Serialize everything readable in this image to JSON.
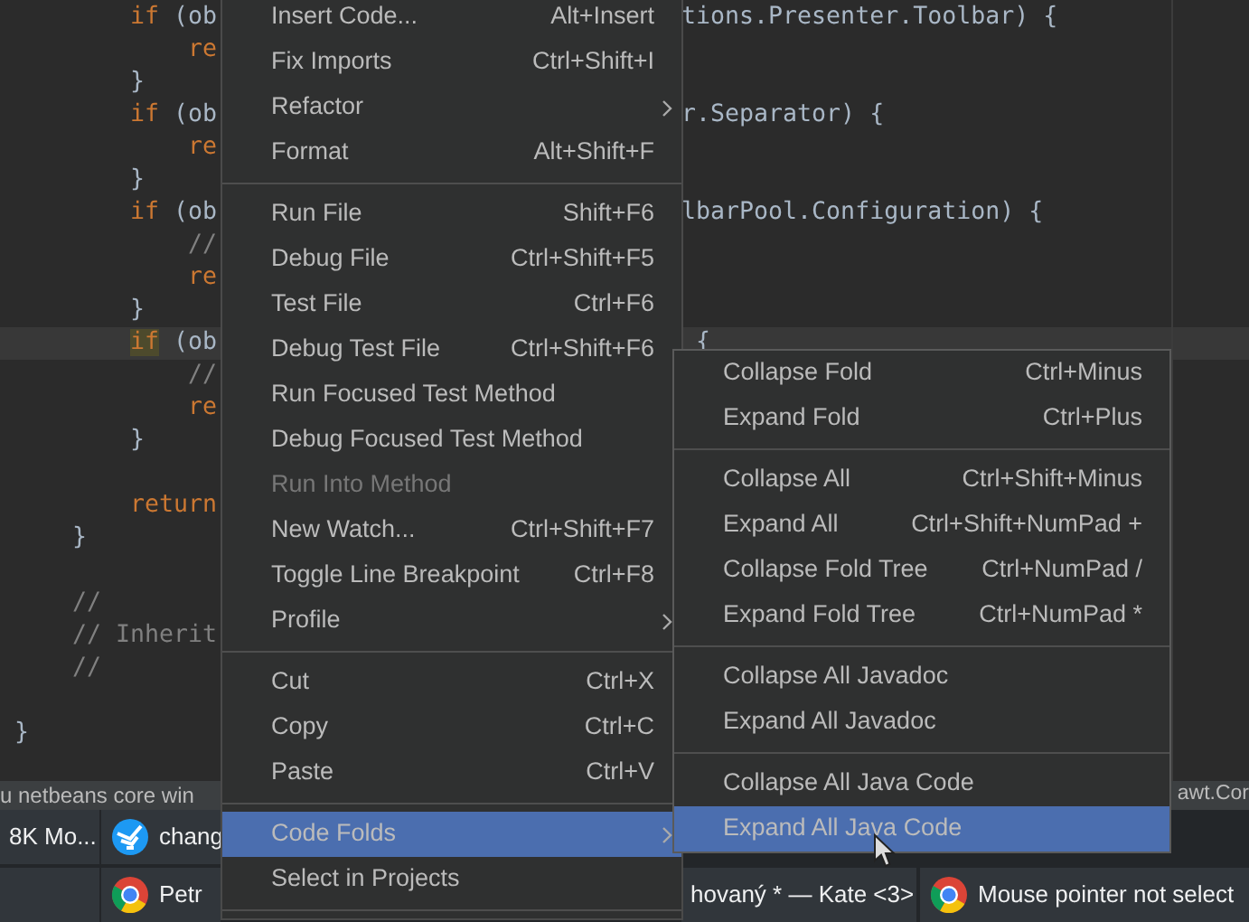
{
  "editor": {
    "lines": [
      {
        "segments": [
          {
            "text": "if",
            "kind": "keyword"
          },
          {
            "text": " (ob",
            "kind": "plain"
          }
        ],
        "right": "tions.Presenter.Toolbar) {",
        "current": false
      },
      {
        "segments": [
          {
            "text": "re",
            "kind": "keyword"
          }
        ],
        "current": false
      },
      {
        "segments": [
          {
            "text": "}",
            "kind": "plain"
          }
        ],
        "current": false
      },
      {
        "segments": [
          {
            "text": "if",
            "kind": "keyword"
          },
          {
            "text": " (ob",
            "kind": "plain"
          }
        ],
        "right": "r.Separator) {",
        "current": false
      },
      {
        "segments": [
          {
            "text": "re",
            "kind": "keyword"
          }
        ],
        "current": false
      },
      {
        "segments": [
          {
            "text": "}",
            "kind": "plain"
          }
        ],
        "current": false
      },
      {
        "segments": [
          {
            "text": "if",
            "kind": "keyword"
          },
          {
            "text": " (ob",
            "kind": "plain"
          }
        ],
        "right": "lbarPool.Configuration) {",
        "current": false
      },
      {
        "segments": [
          {
            "text": "//",
            "kind": "comment"
          }
        ],
        "current": false
      },
      {
        "segments": [
          {
            "text": "re",
            "kind": "keyword"
          }
        ],
        "current": false
      },
      {
        "segments": [
          {
            "text": "}",
            "kind": "plain"
          }
        ],
        "current": false
      },
      {
        "segments": [
          {
            "text": "if",
            "kind": "keyword"
          },
          {
            "text": " (ob",
            "kind": "plain"
          }
        ],
        "right": "{",
        "current": true
      },
      {
        "segments": [
          {
            "text": "//",
            "kind": "comment"
          }
        ],
        "current": false
      },
      {
        "segments": [
          {
            "text": "re",
            "kind": "keyword"
          }
        ],
        "current": false
      },
      {
        "segments": [
          {
            "text": "}",
            "kind": "plain"
          }
        ],
        "current": false
      },
      {
        "segments": [
          {
            "text": "return",
            "kind": "keyword"
          }
        ],
        "current": false
      },
      {
        "segments": [
          {
            "text": "}",
            "kind": "plain"
          }
        ],
        "current": false
      },
      {
        "segments": [
          {
            "text": "//",
            "kind": "comment"
          }
        ],
        "current": false
      },
      {
        "segments": [
          {
            "text": "// Inherit",
            "kind": "comment"
          }
        ],
        "current": false
      },
      {
        "segments": [
          {
            "text": "//",
            "kind": "comment"
          }
        ],
        "current": false
      },
      {
        "segments": [
          {
            "text": "}",
            "kind": "plain"
          }
        ],
        "current": false
      }
    ]
  },
  "output_strip": {
    "left": "u netbeans core win",
    "right": "awt.Cor"
  },
  "taskbar": {
    "tasks": [
      {
        "label": "8K Mo..."
      },
      {
        "label": "chang"
      },
      {
        "label": "Petr"
      },
      {
        "label": "hovaný * — Kate <3>"
      },
      {
        "label": "Mouse pointer not select"
      }
    ]
  },
  "context_menu": {
    "items": [
      {
        "kind": "item",
        "label": "Insert Code...",
        "shortcut": "Alt+Insert",
        "submenu": false,
        "disabled": false,
        "selected": false
      },
      {
        "kind": "item",
        "label": "Fix Imports",
        "shortcut": "Ctrl+Shift+I",
        "submenu": false,
        "disabled": false,
        "selected": false
      },
      {
        "kind": "item",
        "label": "Refactor",
        "submenu": true,
        "disabled": false,
        "selected": false
      },
      {
        "kind": "item",
        "label": "Format",
        "shortcut": "Alt+Shift+F",
        "submenu": false,
        "disabled": false,
        "selected": false
      },
      {
        "kind": "separator"
      },
      {
        "kind": "item",
        "label": "Run File",
        "shortcut": "Shift+F6",
        "submenu": false,
        "disabled": false,
        "selected": false
      },
      {
        "kind": "item",
        "label": "Debug File",
        "shortcut": "Ctrl+Shift+F5",
        "submenu": false,
        "disabled": false,
        "selected": false
      },
      {
        "kind": "item",
        "label": "Test File",
        "shortcut": "Ctrl+F6",
        "submenu": false,
        "disabled": false,
        "selected": false
      },
      {
        "kind": "item",
        "label": "Debug Test File",
        "shortcut": "Ctrl+Shift+F6",
        "submenu": false,
        "disabled": false,
        "selected": false
      },
      {
        "kind": "item",
        "label": "Run Focused Test Method",
        "submenu": false,
        "disabled": false,
        "selected": false
      },
      {
        "kind": "item",
        "label": "Debug Focused Test Method",
        "submenu": false,
        "disabled": false,
        "selected": false
      },
      {
        "kind": "item",
        "label": "Run Into Method",
        "submenu": false,
        "disabled": true,
        "selected": false
      },
      {
        "kind": "item",
        "label": "New Watch...",
        "shortcut": "Ctrl+Shift+F7",
        "submenu": false,
        "disabled": false,
        "selected": false
      },
      {
        "kind": "item",
        "label": "Toggle Line Breakpoint",
        "shortcut": "Ctrl+F8",
        "submenu": false,
        "disabled": false,
        "selected": false
      },
      {
        "kind": "item",
        "label": "Profile",
        "submenu": true,
        "disabled": false,
        "selected": false
      },
      {
        "kind": "separator"
      },
      {
        "kind": "item",
        "label": "Cut",
        "shortcut": "Ctrl+X",
        "submenu": false,
        "disabled": false,
        "selected": false
      },
      {
        "kind": "item",
        "label": "Copy",
        "shortcut": "Ctrl+C",
        "submenu": false,
        "disabled": false,
        "selected": false
      },
      {
        "kind": "item",
        "label": "Paste",
        "shortcut": "Ctrl+V",
        "submenu": false,
        "disabled": false,
        "selected": false
      },
      {
        "kind": "separator"
      },
      {
        "kind": "item",
        "label": "Code Folds",
        "submenu": true,
        "disabled": false,
        "selected": true
      },
      {
        "kind": "item",
        "label": "Select in Projects",
        "submenu": false,
        "disabled": false,
        "selected": false
      },
      {
        "kind": "separator"
      }
    ]
  },
  "submenu": {
    "items": [
      {
        "kind": "item",
        "label": "Collapse Fold",
        "shortcut": "Ctrl+Minus",
        "selected": false
      },
      {
        "kind": "item",
        "label": "Expand Fold",
        "shortcut": "Ctrl+Plus",
        "selected": false
      },
      {
        "kind": "separator"
      },
      {
        "kind": "item",
        "label": "Collapse All",
        "shortcut": "Ctrl+Shift+Minus",
        "selected": false
      },
      {
        "kind": "item",
        "label": "Expand All",
        "shortcut": "Ctrl+Shift+NumPad +",
        "selected": false
      },
      {
        "kind": "item",
        "label": "Collapse Fold Tree",
        "shortcut": "Ctrl+NumPad /",
        "selected": false
      },
      {
        "kind": "item",
        "label": "Expand Fold Tree",
        "shortcut": "Ctrl+NumPad *",
        "selected": false
      },
      {
        "kind": "separator"
      },
      {
        "kind": "item",
        "label": "Collapse All Javadoc",
        "selected": false
      },
      {
        "kind": "item",
        "label": "Expand All Javadoc",
        "selected": false
      },
      {
        "kind": "separator"
      },
      {
        "kind": "item",
        "label": "Collapse All Java Code",
        "selected": false
      },
      {
        "kind": "item",
        "label": "Expand All Java Code",
        "selected": true
      }
    ]
  }
}
